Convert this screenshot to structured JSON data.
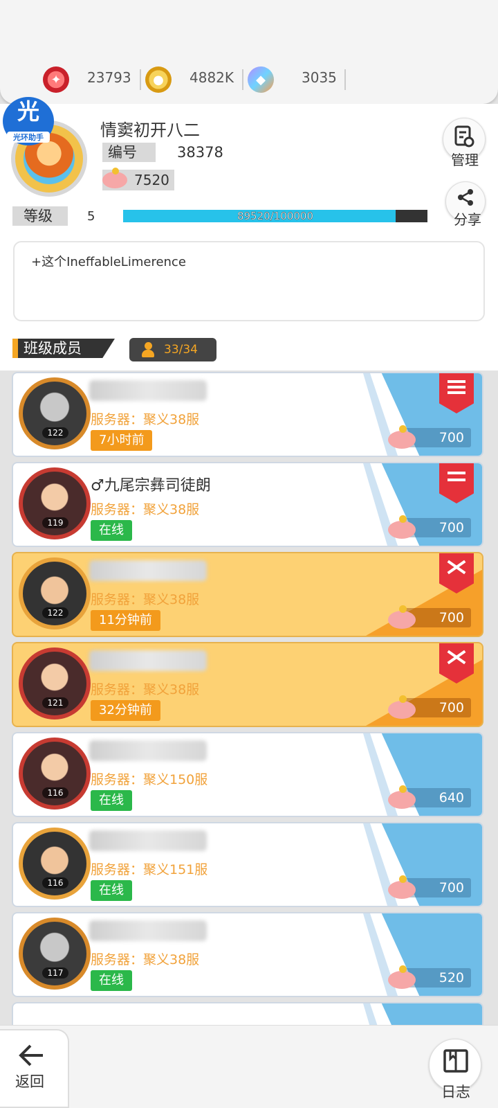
{
  "currencies": [
    {
      "icon": "ruby-coin-icon",
      "value": "23793"
    },
    {
      "icon": "gold-coin-icon",
      "value": "4882K"
    },
    {
      "icon": "gem-key-icon",
      "value": "3035"
    }
  ],
  "app_badge": {
    "glyph": "光",
    "label": "光环助手"
  },
  "profile": {
    "name": "情窦初开八二",
    "id_label": "编号",
    "id_value": "38378",
    "piggy_value": "7520",
    "level_label": "等级",
    "level_value": "5",
    "xp_text": "89520/100000",
    "xp_progress": 0.8952,
    "description": "+这个IneffableLimerence"
  },
  "side_buttons": {
    "manage": "管理",
    "share": "分享"
  },
  "section": {
    "title": "班级成员",
    "count": "33/34"
  },
  "members": [
    {
      "name": "",
      "server": "服务器：聚义38服",
      "status": "7小时前",
      "status_type": "away",
      "level": "122",
      "contribution": "700",
      "rank": "monitor",
      "style": "blue"
    },
    {
      "name": "♂九尾宗彝司徒朗",
      "server": "服务器：聚义38服",
      "status": "在线",
      "status_type": "online",
      "level": "119",
      "contribution": "700",
      "rank": "vice-monitor",
      "style": "blue"
    },
    {
      "name": "",
      "server": "服务器：聚义38服",
      "status": "11分钟前",
      "status_type": "away",
      "level": "122",
      "contribution": "700",
      "rank": "elite",
      "style": "gold"
    },
    {
      "name": "",
      "server": "服务器：聚义38服",
      "status": "32分钟前",
      "status_type": "away",
      "level": "121",
      "contribution": "700",
      "rank": "elite",
      "style": "gold"
    },
    {
      "name": "",
      "server": "服务器：聚义150服",
      "status": "在线",
      "status_type": "online",
      "level": "116",
      "contribution": "640",
      "rank": "",
      "style": "blue"
    },
    {
      "name": "",
      "server": "服务器：聚义151服",
      "status": "在线",
      "status_type": "online",
      "level": "116",
      "contribution": "700",
      "rank": "",
      "style": "blue"
    },
    {
      "name": "",
      "server": "服务器：聚义38服",
      "status": "在线",
      "status_type": "online",
      "level": "117",
      "contribution": "520",
      "rank": "",
      "style": "blue"
    }
  ],
  "bottom_nav": {
    "back": "返回",
    "log": "日志"
  },
  "colors": {
    "accent_orange": "#f5a623",
    "online_green": "#2bb84a",
    "away_orange": "#f39a1c",
    "xp_cyan": "#27c2ea",
    "rank_red": "#e5313a"
  }
}
